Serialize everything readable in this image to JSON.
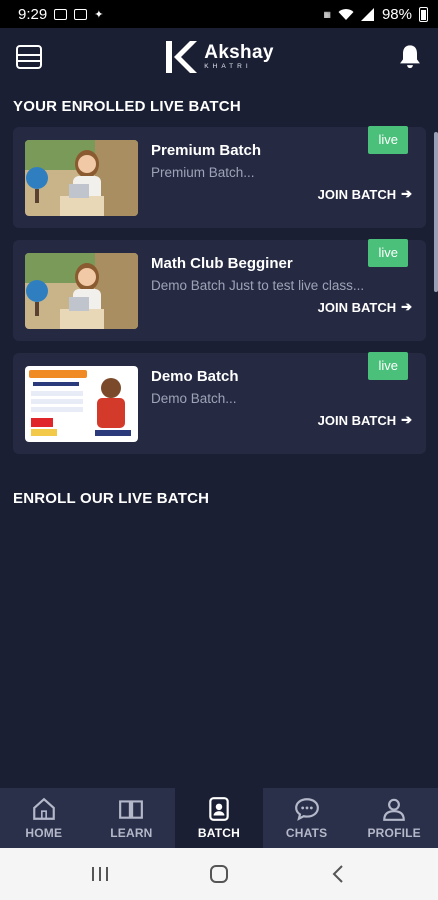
{
  "status": {
    "time": "9:29",
    "battery": "98%"
  },
  "header": {
    "logo_title": "Akshay",
    "logo_sub": "KHATRI"
  },
  "enrolled_section": {
    "title": "YOUR ENROLLED LIVE BATCH"
  },
  "batches": [
    {
      "title": "Premium Batch",
      "desc": "Premium Batch...",
      "badge": "live",
      "join_label": "JOIN BATCH",
      "thumb": "classroom-girl"
    },
    {
      "title": "Math Club Begginer",
      "desc": "Demo Batch Just to test live class...",
      "badge": "live",
      "join_label": "JOIN BATCH",
      "thumb": "classroom-girl"
    },
    {
      "title": "Demo Batch",
      "desc": "Demo Batch...",
      "badge": "live",
      "join_label": "JOIN BATCH",
      "thumb": "promo-flyer"
    }
  ],
  "enroll_section": {
    "title": "ENROLL OUR LIVE BATCH"
  },
  "bottom_nav": [
    {
      "label": "HOME",
      "icon": "home-icon"
    },
    {
      "label": "LEARN",
      "icon": "book-icon"
    },
    {
      "label": "BATCH",
      "icon": "batch-icon",
      "active": true
    },
    {
      "label": "CHATS",
      "icon": "chat-icon"
    },
    {
      "label": "PROFILE",
      "icon": "profile-icon"
    }
  ],
  "colors": {
    "background": "#1b1f34",
    "card": "#252a42",
    "live": "#4ac07a",
    "nav": "#2a2f4a"
  }
}
